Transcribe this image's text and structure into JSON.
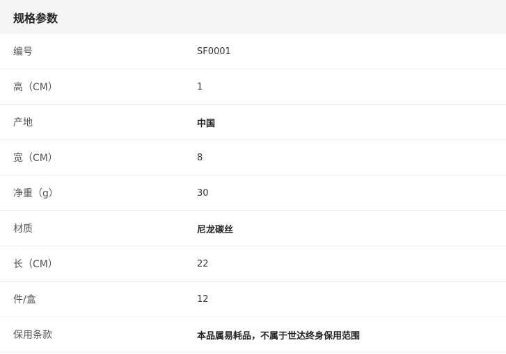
{
  "header": {
    "title": "规格参数"
  },
  "specs": [
    {
      "label": "编号",
      "value": "SF0001",
      "bold": false
    },
    {
      "label": "高（CM）",
      "value": "1",
      "bold": false
    },
    {
      "label": "产地",
      "value": "中国",
      "bold": true
    },
    {
      "label": "宽（CM）",
      "value": "8",
      "bold": false
    },
    {
      "label": "净重（g）",
      "value": "30",
      "bold": false
    },
    {
      "label": "材质",
      "value": "尼龙碳丝",
      "bold": true
    },
    {
      "label": "长（CM）",
      "value": "22",
      "bold": false
    },
    {
      "label": "件/盒",
      "value": "12",
      "bold": false
    },
    {
      "label": "保用条款",
      "value": "本品属易耗品，不属于世达终身保用范围",
      "bold": true
    }
  ]
}
